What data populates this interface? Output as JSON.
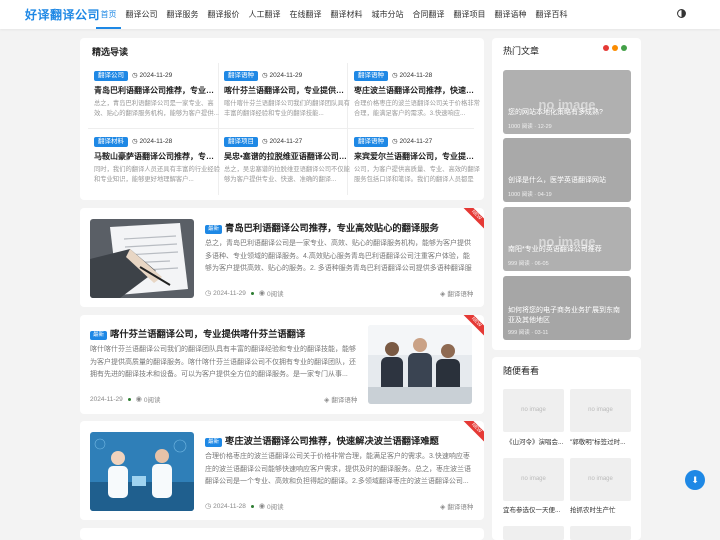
{
  "header": {
    "logo": "好译翻译公司",
    "nav": [
      "首页",
      "翻译公司",
      "翻译服务",
      "翻译报价",
      "人工翻译",
      "在线翻译",
      "翻译材料",
      "城市分站",
      "合同翻译",
      "翻译项目",
      "翻译语种",
      "翻译百科"
    ]
  },
  "featured": {
    "title": "精选导读",
    "items": [
      {
        "tag": "翻译公司",
        "date": "2024-11-29",
        "title": "青岛巴利语翻译公司推荐，专业高效",
        "summary": "总之，青岛巴利语翻译公司是一家专业、高效、贴心的翻译服务机构，能够为客户提供..."
      },
      {
        "tag": "翻译语种",
        "date": "2024-11-29",
        "title": "喀什芬兰语翻译公司，专业提供喀什芬兰语翻译",
        "summary": "喀什喀什芬兰语翻译公司我们的翻译团队具有丰富的翻译经验和专业的翻译技能..."
      },
      {
        "tag": "翻译语种",
        "date": "2024-11-28",
        "title": "枣庄波兰语翻译公司推荐，快速解决波兰语翻译",
        "summary": "合理价格枣庄的波兰语翻译公司关于价格非常合理，能满足客户的需求。3.快速响应..."
      },
      {
        "tag": "翻译材料",
        "date": "2024-11-28",
        "title": "马鞍山豪萨语翻译公司推荐，专业可靠",
        "summary": "同时，我们的翻译人员还具有丰富的行业经验和专业知识，能够更好地理解客户..."
      },
      {
        "tag": "翻译项目",
        "date": "2024-11-27",
        "title": "吴忠•塞谱的拉脱维亚语翻译公司推荐",
        "summary": "总之，吴忠塞谱的拉脱维亚语翻译公司不仅能够为客户提供专业、快速、准确的翻译..."
      },
      {
        "tag": "翻译语种",
        "date": "2024-11-27",
        "title": "来宾爱尔兰语翻译公司，专业提供爱尔兰语翻译",
        "summary": "公司，为客户提供高质量、专业、高效的翻译服务包括口译和笔译。我们的翻译人员都是经..."
      }
    ]
  },
  "posts": [
    {
      "new": "最新",
      "title": "青岛巴利语翻译公司推荐，专业高效贴心的翻译服务",
      "summary": "总之，青岛巴利语翻译公司是一家专业、高效、贴心的翻译服务机构，能够为客户提供多语种、专业领域的翻译服务。4.高效贴心服务青岛巴利语翻译公司注重客户体验，能够为客户提供高效、贴心的服务。2. 多语种服务青岛巴利语翻译公司提供多语种翻译服务...",
      "date": "2024-11-29",
      "reads": "0阅读",
      "cat": "翻译语种",
      "ribbon": "NEW"
    },
    {
      "new": "最新",
      "title": "喀什芬兰语翻译公司，专业提供喀什芬兰语翻译",
      "summary": "喀什喀什芬兰语翻译公司我们的翻译团队具有丰富的翻译经验和专业的翻译技能，能够为客户提供高质量的翻译服务。喀什喀什芬兰语翻译公司不仅拥有专业的翻译团队，还拥有先进的翻译技术和设备。可以为客户提供全方位的翻译服务。是一家专门从事...",
      "date": "2024-11-29",
      "reads": "0阅读",
      "cat": "翻译语种",
      "ribbon": "NEW"
    },
    {
      "new": "最新",
      "title": "枣庄波兰语翻译公司推荐，快速解决波兰语翻译难题",
      "summary": "合理价格枣庄的波兰语翻译公司关于价格非常合理，能满足客户的需求。3.快速响应枣庄的波兰语翻译公司能够快速响应客户需求，提供及时的翻译服务。总之，枣庄波兰语翻译公司是一个专业、高效和负担得起的翻译。2.多领域翻译枣庄的波兰语翻译公司...",
      "date": "2024-11-28",
      "reads": "0阅读",
      "cat": "翻译语种",
      "ribbon": "NEW"
    }
  ],
  "hot": {
    "title": "热门文章",
    "dot_colors": [
      "#e53935",
      "#fb8c00",
      "#43a047"
    ],
    "items": [
      {
        "title": "您的网站本地化策略有多成熟?",
        "meta": "1000 阅读 · 12-29",
        "placeholder": "no image"
      },
      {
        "title": "创译是什么，医学英语翻译网站",
        "meta": "1000 阅读 · 04-19",
        "placeholder": ""
      },
      {
        "title": "南阳*专业的英语翻译公司推荐",
        "meta": "999 阅读 · 06-05",
        "placeholder": "no image"
      },
      {
        "title": "如何将您的电子商务业务扩展到东南亚及其他地区",
        "meta": "999 阅读 · 03-11",
        "placeholder": ""
      }
    ]
  },
  "random": {
    "title": "随便看看",
    "items": [
      {
        "img": "no image",
        "caption": "《山河令》演唱会..."
      },
      {
        "img": "no image",
        "caption": "\"郭敬明\"标签过时..."
      },
      {
        "img": "no image",
        "caption": "宜布参选仅一天便..."
      },
      {
        "img": "no image",
        "caption": "抢抓农时生产忙"
      }
    ]
  },
  "colors": {
    "accent": "#1e88e5",
    "ribbon": "#e53935"
  }
}
